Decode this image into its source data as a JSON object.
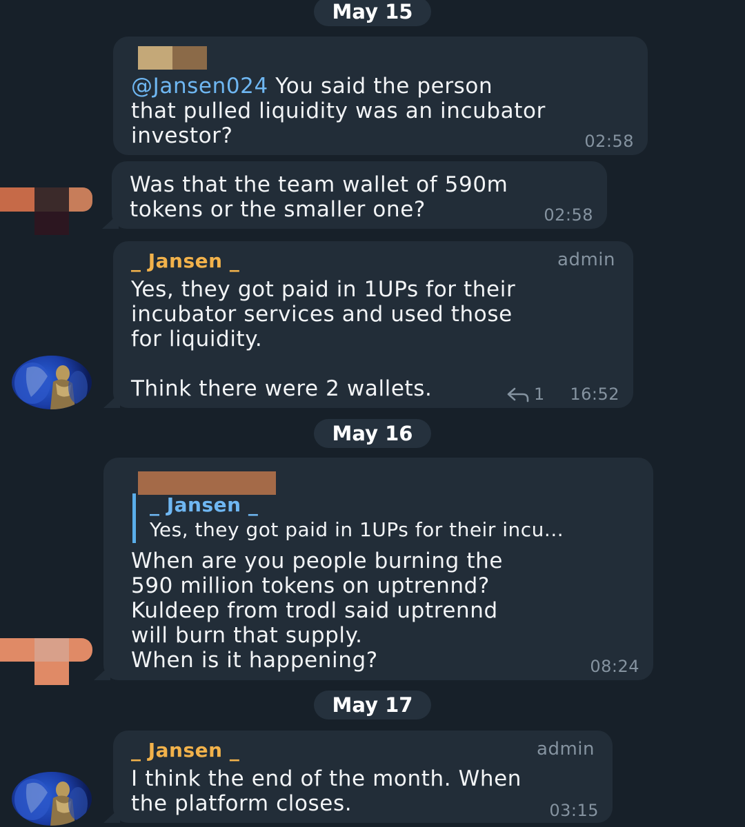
{
  "dates": [
    "May 15",
    "May 16",
    "May 17"
  ],
  "messages": [
    {
      "mention": "@Jansen024",
      "text_after_mention": " You said the person\nthat pulled liquidity was an incubator\ninvestor?",
      "time": "02:58"
    },
    {
      "text": "Was that the team wallet of 590m\ntokens or the smaller one?",
      "time": "02:58"
    },
    {
      "sender": "_ Jansen _",
      "role": "admin",
      "text": "Yes, they got paid in 1UPs for their\nincubator services and used those\nfor liquidity.\n\nThink there were 2 wallets.",
      "reply_count": "1",
      "time": "16:52"
    },
    {
      "quote_sender": "_ Jansen _",
      "quote_text": "Yes, they got paid in 1UPs for their incu...",
      "text": "When are you people burning the\n590 million tokens on uptrennd?\nKuldeep from trodl said uptrennd\nwill burn that supply.\nWhen is it happening?",
      "time": "08:24"
    },
    {
      "sender": "_ Jansen _",
      "role": "admin",
      "text": "I think the end of the month. When\nthe platform closes.",
      "time": "03:15"
    }
  ],
  "icons": {
    "reply": "reply-arrow-icon",
    "avatar": "angel-statue-avatar"
  },
  "colors": {
    "background": "#172029",
    "bubble": "#222d38",
    "mention": "#6fb7f2",
    "admin_name": "#f2b24b",
    "meta": "#8593a0"
  }
}
